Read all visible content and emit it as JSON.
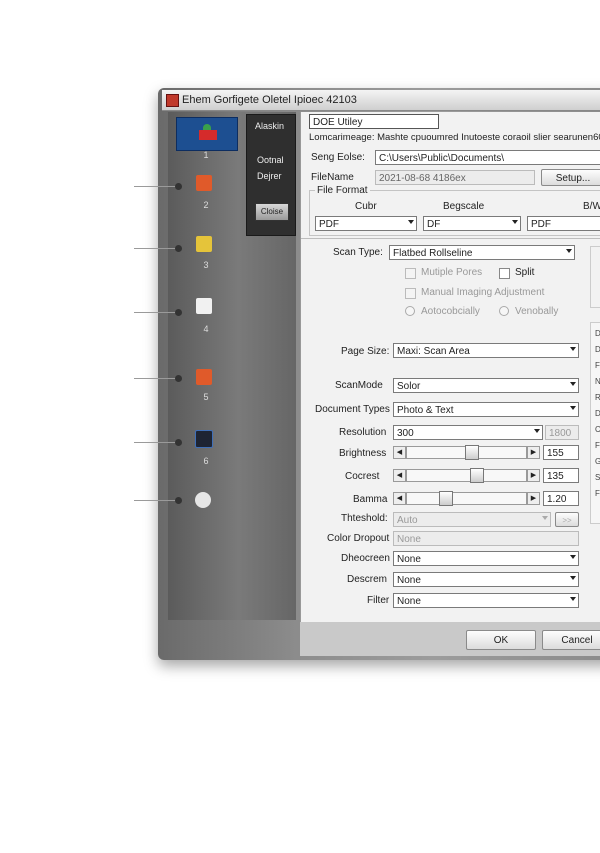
{
  "window": {
    "title": "Ehem Gorfigete Oletel Ipioec 42103",
    "utility_label": "DOE Utiley",
    "description": "Lomcarimeage: Mashte cpuoumred Inutoeste coraoil slier searunen60"
  },
  "sidebar": {
    "items": [
      {
        "num": "1",
        "icon": "scanner-icon"
      },
      {
        "num": "2",
        "icon": "printer-icon"
      },
      {
        "num": "3",
        "icon": "mail-icon"
      },
      {
        "num": "4",
        "icon": "document-icon"
      },
      {
        "num": "5",
        "icon": "printer-icon"
      },
      {
        "num": "6",
        "icon": "camera-icon"
      },
      {
        "num": "",
        "icon": "disc-icon"
      }
    ],
    "panel": {
      "top": "Alaskin",
      "mid": "Ootnal",
      "mid2": "Dejrer",
      "close": "Cloise"
    }
  },
  "settings": {
    "save_folder_label": "Seng Eolse:",
    "save_folder_value": "C:\\Users\\Public\\Documents\\",
    "file_name_label": "FileName",
    "file_name_value": "2021-08-68 4186ex",
    "setup_label": "Setup...",
    "file_format_label": "File Format",
    "format_cols": [
      {
        "header": "Cubr",
        "value": "PDF"
      },
      {
        "header": "Begscale",
        "value": "DF"
      },
      {
        "header": "B/W",
        "value": "PDF"
      }
    ],
    "scan_type_label": "Scan Type:",
    "scan_type_value": "Flatbed Rollseline",
    "multiple_pages_label": "Mutiple Pores",
    "split_label": "Split",
    "manual_label": "Manual Imaging Adjustment",
    "auto_label": "Aotocobcially",
    "visually_label": "Venobally",
    "page_size_label": "Page Size:",
    "page_size_value": "Maxi: Scan Area",
    "scan_mode_label": "ScanMode",
    "scan_mode_value": "Solor",
    "doc_type_label": "Document Types",
    "doc_type_value": "Photo & Text",
    "resolution_label": "Resolution",
    "resolution_value": "300",
    "resolution_extra": "1800",
    "brightness_label": "Brightness",
    "brightness_value": "155",
    "brightness_level": 0.55,
    "contrast_label": "Cocrest",
    "contrast_value": "135",
    "contrast_level": 0.6,
    "gamma_label": "Bamma",
    "gamma_value": "1.20",
    "gamma_level": 0.3,
    "threshold_label": "Thteshold:",
    "threshold_value": "Auto",
    "color_dropout_label": "Color Dropout",
    "color_dropout_value": "None",
    "descreen1_label": "Dheocreen",
    "descreen1_value": "None",
    "descreen2_label": "Descrem",
    "descreen2_value": "None",
    "filter_label": "Filter",
    "filter_value": "None"
  },
  "footer": {
    "ok": "OK",
    "cancel": "Cancel"
  },
  "right_strip": [
    "D",
    "D",
    "F",
    "N",
    "R",
    "D",
    "C",
    "F",
    "G",
    "S",
    "F"
  ]
}
